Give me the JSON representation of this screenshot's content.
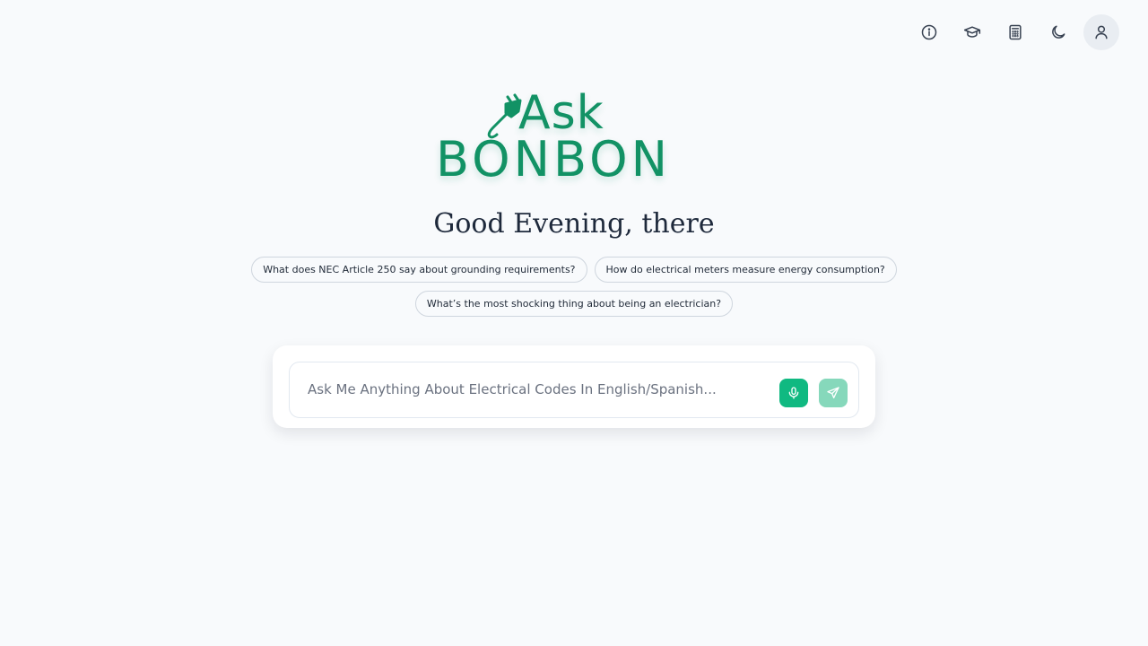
{
  "header": {
    "icons": [
      "info-icon",
      "graduation-cap-icon",
      "calculator-icon",
      "moon-icon",
      "user-icon"
    ]
  },
  "logo": {
    "line1": "Ask",
    "line2": "BONBON",
    "color": "#129265"
  },
  "greeting": "Good Evening, there",
  "suggestions": [
    "What does NEC Article 250 say about grounding requirements?",
    "How do electrical meters measure energy consumption?",
    "What’s the most shocking thing about being an electrician?"
  ],
  "composer": {
    "placeholder": "Ask Me Anything About Electrical Codes In English/Spanish...",
    "value": ""
  },
  "colors": {
    "accent": "#10b981",
    "accent_light": "#86d8bb",
    "background": "#f8fafc"
  }
}
